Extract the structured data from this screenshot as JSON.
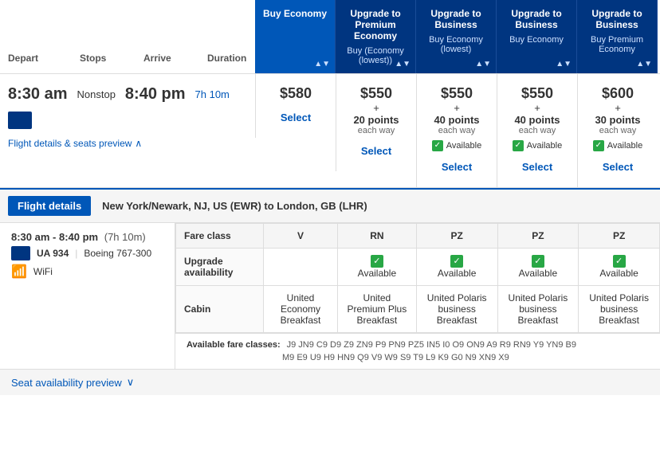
{
  "columns": {
    "labels": [
      "",
      "Buy Economy",
      "Upgrade to Premium Economy",
      "Upgrade to Business",
      "Upgrade to Business",
      "Upgrade to Business"
    ],
    "sub_labels": [
      "",
      "",
      "Buy (Economy (lowest))",
      "Buy Economy (lowest)",
      "Buy Economy",
      "Buy Premium Economy"
    ],
    "fare_classes": [
      "",
      "V",
      "RN",
      "PZ",
      "PZ",
      "PZ"
    ]
  },
  "flight_meta": {
    "depart_time": "8:30 am",
    "arrive_time": "8:40 pm",
    "stops": "Nonstop",
    "duration": "7h 10m",
    "depart_label": "Depart",
    "stops_label": "Stops",
    "arrive_label": "Arrive",
    "duration_label": "Duration"
  },
  "prices": [
    {
      "main": "$580",
      "plus": "",
      "points": "",
      "each": "",
      "available": false
    },
    {
      "main": "$550",
      "plus": "+",
      "points": "20 points",
      "each": "each way",
      "available": false
    },
    {
      "main": "$550",
      "plus": "+",
      "points": "40 points",
      "each": "each way",
      "available": true
    },
    {
      "main": "$550",
      "plus": "+",
      "points": "40 points",
      "each": "each way",
      "available": true
    },
    {
      "main": "$600",
      "plus": "+",
      "points": "30 points",
      "each": "each way",
      "available": true
    }
  ],
  "select_label": "Select",
  "flight_details_link": "Flight details & seats preview",
  "details": {
    "tab_label": "Flight details",
    "route": "New York/Newark, NJ, US (EWR) to London, GB (LHR)",
    "time_range": "8:30 am - 8:40 pm",
    "duration_paren": "(7h 10m)",
    "flight_id": "UA 934",
    "aircraft": "Boeing 767-300",
    "wifi": "WiFi",
    "fare_class_label": "Fare class",
    "upgrade_avail_label": "Upgrade availability",
    "cabin_label": "Cabin",
    "fare_classes": [
      "V",
      "RN",
      "PZ",
      "PZ",
      "PZ"
    ],
    "upgrade_availability": [
      false,
      true,
      true,
      true,
      true
    ],
    "upgrade_avail_text": "Available",
    "cabins": [
      "United Economy Breakfast",
      "United Premium Plus Breakfast",
      "United Polaris business Breakfast",
      "United Polaris business Breakfast",
      "United Polaris business Breakfast"
    ],
    "avail_fare_classes_label": "Available fare classes:",
    "avail_fare_classes_line1": "J9 JN9 C9 D9 Z9 ZN9 P9 PN9 PZ5 IN5 I0 O9 ON9 A9 R9 RN9 Y9 YN9 B9",
    "avail_fare_classes_line2": "M9 E9 U9 H9 HN9 Q9 V9 W9 S9 T9 L9 K9 G0 N9 XN9 X9",
    "seat_preview_label": "Seat availability preview"
  }
}
